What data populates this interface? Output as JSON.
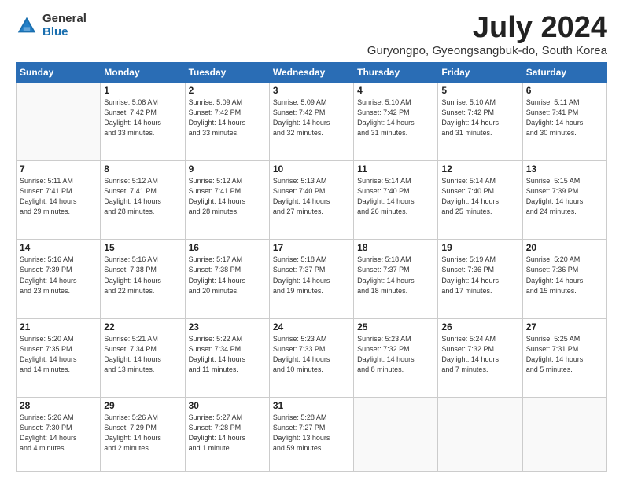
{
  "logo": {
    "general": "General",
    "blue": "Blue"
  },
  "title": {
    "month": "July 2024",
    "location": "Guryongpo, Gyeongsangbuk-do, South Korea"
  },
  "days_header": [
    "Sunday",
    "Monday",
    "Tuesday",
    "Wednesday",
    "Thursday",
    "Friday",
    "Saturday"
  ],
  "weeks": [
    [
      {
        "num": "",
        "info": ""
      },
      {
        "num": "1",
        "info": "Sunrise: 5:08 AM\nSunset: 7:42 PM\nDaylight: 14 hours\nand 33 minutes."
      },
      {
        "num": "2",
        "info": "Sunrise: 5:09 AM\nSunset: 7:42 PM\nDaylight: 14 hours\nand 33 minutes."
      },
      {
        "num": "3",
        "info": "Sunrise: 5:09 AM\nSunset: 7:42 PM\nDaylight: 14 hours\nand 32 minutes."
      },
      {
        "num": "4",
        "info": "Sunrise: 5:10 AM\nSunset: 7:42 PM\nDaylight: 14 hours\nand 31 minutes."
      },
      {
        "num": "5",
        "info": "Sunrise: 5:10 AM\nSunset: 7:42 PM\nDaylight: 14 hours\nand 31 minutes."
      },
      {
        "num": "6",
        "info": "Sunrise: 5:11 AM\nSunset: 7:41 PM\nDaylight: 14 hours\nand 30 minutes."
      }
    ],
    [
      {
        "num": "7",
        "info": "Sunrise: 5:11 AM\nSunset: 7:41 PM\nDaylight: 14 hours\nand 29 minutes."
      },
      {
        "num": "8",
        "info": "Sunrise: 5:12 AM\nSunset: 7:41 PM\nDaylight: 14 hours\nand 28 minutes."
      },
      {
        "num": "9",
        "info": "Sunrise: 5:12 AM\nSunset: 7:41 PM\nDaylight: 14 hours\nand 28 minutes."
      },
      {
        "num": "10",
        "info": "Sunrise: 5:13 AM\nSunset: 7:40 PM\nDaylight: 14 hours\nand 27 minutes."
      },
      {
        "num": "11",
        "info": "Sunrise: 5:14 AM\nSunset: 7:40 PM\nDaylight: 14 hours\nand 26 minutes."
      },
      {
        "num": "12",
        "info": "Sunrise: 5:14 AM\nSunset: 7:40 PM\nDaylight: 14 hours\nand 25 minutes."
      },
      {
        "num": "13",
        "info": "Sunrise: 5:15 AM\nSunset: 7:39 PM\nDaylight: 14 hours\nand 24 minutes."
      }
    ],
    [
      {
        "num": "14",
        "info": "Sunrise: 5:16 AM\nSunset: 7:39 PM\nDaylight: 14 hours\nand 23 minutes."
      },
      {
        "num": "15",
        "info": "Sunrise: 5:16 AM\nSunset: 7:38 PM\nDaylight: 14 hours\nand 22 minutes."
      },
      {
        "num": "16",
        "info": "Sunrise: 5:17 AM\nSunset: 7:38 PM\nDaylight: 14 hours\nand 20 minutes."
      },
      {
        "num": "17",
        "info": "Sunrise: 5:18 AM\nSunset: 7:37 PM\nDaylight: 14 hours\nand 19 minutes."
      },
      {
        "num": "18",
        "info": "Sunrise: 5:18 AM\nSunset: 7:37 PM\nDaylight: 14 hours\nand 18 minutes."
      },
      {
        "num": "19",
        "info": "Sunrise: 5:19 AM\nSunset: 7:36 PM\nDaylight: 14 hours\nand 17 minutes."
      },
      {
        "num": "20",
        "info": "Sunrise: 5:20 AM\nSunset: 7:36 PM\nDaylight: 14 hours\nand 15 minutes."
      }
    ],
    [
      {
        "num": "21",
        "info": "Sunrise: 5:20 AM\nSunset: 7:35 PM\nDaylight: 14 hours\nand 14 minutes."
      },
      {
        "num": "22",
        "info": "Sunrise: 5:21 AM\nSunset: 7:34 PM\nDaylight: 14 hours\nand 13 minutes."
      },
      {
        "num": "23",
        "info": "Sunrise: 5:22 AM\nSunset: 7:34 PM\nDaylight: 14 hours\nand 11 minutes."
      },
      {
        "num": "24",
        "info": "Sunrise: 5:23 AM\nSunset: 7:33 PM\nDaylight: 14 hours\nand 10 minutes."
      },
      {
        "num": "25",
        "info": "Sunrise: 5:23 AM\nSunset: 7:32 PM\nDaylight: 14 hours\nand 8 minutes."
      },
      {
        "num": "26",
        "info": "Sunrise: 5:24 AM\nSunset: 7:32 PM\nDaylight: 14 hours\nand 7 minutes."
      },
      {
        "num": "27",
        "info": "Sunrise: 5:25 AM\nSunset: 7:31 PM\nDaylight: 14 hours\nand 5 minutes."
      }
    ],
    [
      {
        "num": "28",
        "info": "Sunrise: 5:26 AM\nSunset: 7:30 PM\nDaylight: 14 hours\nand 4 minutes."
      },
      {
        "num": "29",
        "info": "Sunrise: 5:26 AM\nSunset: 7:29 PM\nDaylight: 14 hours\nand 2 minutes."
      },
      {
        "num": "30",
        "info": "Sunrise: 5:27 AM\nSunset: 7:28 PM\nDaylight: 14 hours\nand 1 minute."
      },
      {
        "num": "31",
        "info": "Sunrise: 5:28 AM\nSunset: 7:27 PM\nDaylight: 13 hours\nand 59 minutes."
      },
      {
        "num": "",
        "info": ""
      },
      {
        "num": "",
        "info": ""
      },
      {
        "num": "",
        "info": ""
      }
    ]
  ]
}
